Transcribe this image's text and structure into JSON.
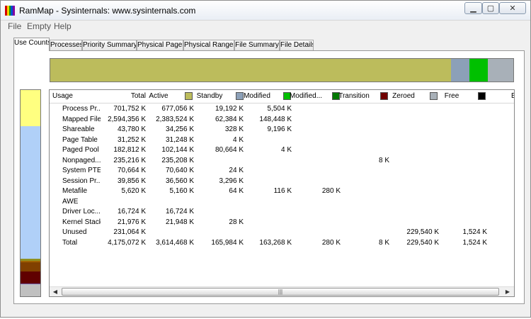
{
  "window": {
    "title": "RamMap - Sysinternals: www.sysinternals.com",
    "icon_colors": [
      "#d40000",
      "#f0d000",
      "#00a000",
      "#0050d0",
      "#8000a0"
    ],
    "minimize_glyph": "▁",
    "maximize_glyph": "▢",
    "close_glyph": "✕"
  },
  "menu": [
    "File",
    "Empty",
    "Help"
  ],
  "tabs": [
    "Use Counts",
    "Processes",
    "Priority Summary",
    "Physical Pages",
    "Physical Ranges",
    "File Summary",
    "File Details"
  ],
  "active_tab": "Use Counts",
  "colors": {
    "active": "#bcbc5c",
    "standby": "#8ca0b8",
    "modified": "#00c000",
    "modified_nowrite": "#007800",
    "transition": "#700000",
    "zeroed": "#a8b0b8",
    "free": "#000000",
    "bad": "#000000",
    "process_private": "#ffff80",
    "mapped_file": "#b0d0f8",
    "shareable": "#909020",
    "page_table": "#a06000",
    "paged_pool": "#804000",
    "nonpaged_pool": "#600000",
    "driver_locked": "#7060b0",
    "unused": "#c0c0c0"
  },
  "topbar_shares": [
    {
      "key": "active",
      "value": 3614468
    },
    {
      "key": "standby",
      "value": 165984
    },
    {
      "key": "modified",
      "value": 163268
    },
    {
      "key": "zeroed",
      "value": 229540
    }
  ],
  "sidebar_shares": [
    {
      "key": "process_private",
      "value": 701752
    },
    {
      "key": "mapped_file",
      "value": 2594356
    },
    {
      "key": "shareable",
      "value": 43780
    },
    {
      "key": "page_table",
      "value": 31252
    },
    {
      "key": "paged_pool",
      "value": 182812
    },
    {
      "key": "nonpaged_pool",
      "value": 235216
    },
    {
      "key": "driver_locked",
      "value": 16724
    },
    {
      "key": "unused",
      "value": 231064
    }
  ],
  "columns": [
    {
      "key": "usage",
      "label": "Usage",
      "align": "left"
    },
    {
      "key": "total",
      "label": "Total",
      "align": "right"
    },
    {
      "key": "active",
      "label": "Active",
      "align": "right",
      "swatch": "active"
    },
    {
      "key": "standby",
      "label": "Standby",
      "align": "right",
      "swatch": "standby"
    },
    {
      "key": "modified",
      "label": "Modified",
      "align": "right",
      "swatch": "modified"
    },
    {
      "key": "modified_nowrite",
      "label": "Modified...",
      "align": "right",
      "swatch": "modified_nowrite"
    },
    {
      "key": "transition",
      "label": "Transition",
      "align": "right",
      "swatch": "transition"
    },
    {
      "key": "zeroed",
      "label": "Zeroed",
      "align": "right",
      "swatch": "zeroed"
    },
    {
      "key": "free",
      "label": "Free",
      "align": "right",
      "swatch": "free"
    },
    {
      "key": "bad",
      "label": "B",
      "align": "right"
    }
  ],
  "rows": [
    {
      "usage": "Process Pr...",
      "total": "701,752 K",
      "active": "677,056 K",
      "standby": "19,192 K",
      "modified": "5,504 K",
      "modified_nowrite": "",
      "transition": "",
      "zeroed": "",
      "free": ""
    },
    {
      "usage": "Mapped File",
      "total": "2,594,356 K",
      "active": "2,383,524 K",
      "standby": "62,384 K",
      "modified": "148,448 K",
      "modified_nowrite": "",
      "transition": "",
      "zeroed": "",
      "free": ""
    },
    {
      "usage": "Shareable",
      "total": "43,780 K",
      "active": "34,256 K",
      "standby": "328 K",
      "modified": "9,196 K",
      "modified_nowrite": "",
      "transition": "",
      "zeroed": "",
      "free": ""
    },
    {
      "usage": "Page Table",
      "total": "31,252 K",
      "active": "31,248 K",
      "standby": "4 K",
      "modified": "",
      "modified_nowrite": "",
      "transition": "",
      "zeroed": "",
      "free": ""
    },
    {
      "usage": "Paged Pool",
      "total": "182,812 K",
      "active": "102,144 K",
      "standby": "80,664 K",
      "modified": "4 K",
      "modified_nowrite": "",
      "transition": "",
      "zeroed": "",
      "free": ""
    },
    {
      "usage": "Nonpaged...",
      "total": "235,216 K",
      "active": "235,208 K",
      "standby": "",
      "modified": "",
      "modified_nowrite": "",
      "transition": "8 K",
      "zeroed": "",
      "free": ""
    },
    {
      "usage": "System PTE",
      "total": "70,664 K",
      "active": "70,640 K",
      "standby": "24 K",
      "modified": "",
      "modified_nowrite": "",
      "transition": "",
      "zeroed": "",
      "free": ""
    },
    {
      "usage": "Session Pr...",
      "total": "39,856 K",
      "active": "36,560 K",
      "standby": "3,296 K",
      "modified": "",
      "modified_nowrite": "",
      "transition": "",
      "zeroed": "",
      "free": ""
    },
    {
      "usage": "Metafile",
      "total": "5,620 K",
      "active": "5,160 K",
      "standby": "64 K",
      "modified": "116 K",
      "modified_nowrite": "280 K",
      "transition": "",
      "zeroed": "",
      "free": ""
    },
    {
      "usage": "AWE",
      "total": "",
      "active": "",
      "standby": "",
      "modified": "",
      "modified_nowrite": "",
      "transition": "",
      "zeroed": "",
      "free": ""
    },
    {
      "usage": "Driver Loc...",
      "total": "16,724 K",
      "active": "16,724 K",
      "standby": "",
      "modified": "",
      "modified_nowrite": "",
      "transition": "",
      "zeroed": "",
      "free": ""
    },
    {
      "usage": "Kernel Stack",
      "total": "21,976 K",
      "active": "21,948 K",
      "standby": "28 K",
      "modified": "",
      "modified_nowrite": "",
      "transition": "",
      "zeroed": "",
      "free": ""
    },
    {
      "usage": "Unused",
      "total": "231,064 K",
      "active": "",
      "standby": "",
      "modified": "",
      "modified_nowrite": "",
      "transition": "",
      "zeroed": "229,540 K",
      "free": "1,524 K"
    },
    {
      "usage": "Total",
      "total": "4,175,072 K",
      "active": "3,614,468 K",
      "standby": "165,984 K",
      "modified": "163,268 K",
      "modified_nowrite": "280 K",
      "transition": "8 K",
      "zeroed": "229,540 K",
      "free": "1,524 K"
    }
  ],
  "scrollbar": {
    "left_glyph": "◀",
    "right_glyph": "▶",
    "grip_glyph": "|||"
  }
}
